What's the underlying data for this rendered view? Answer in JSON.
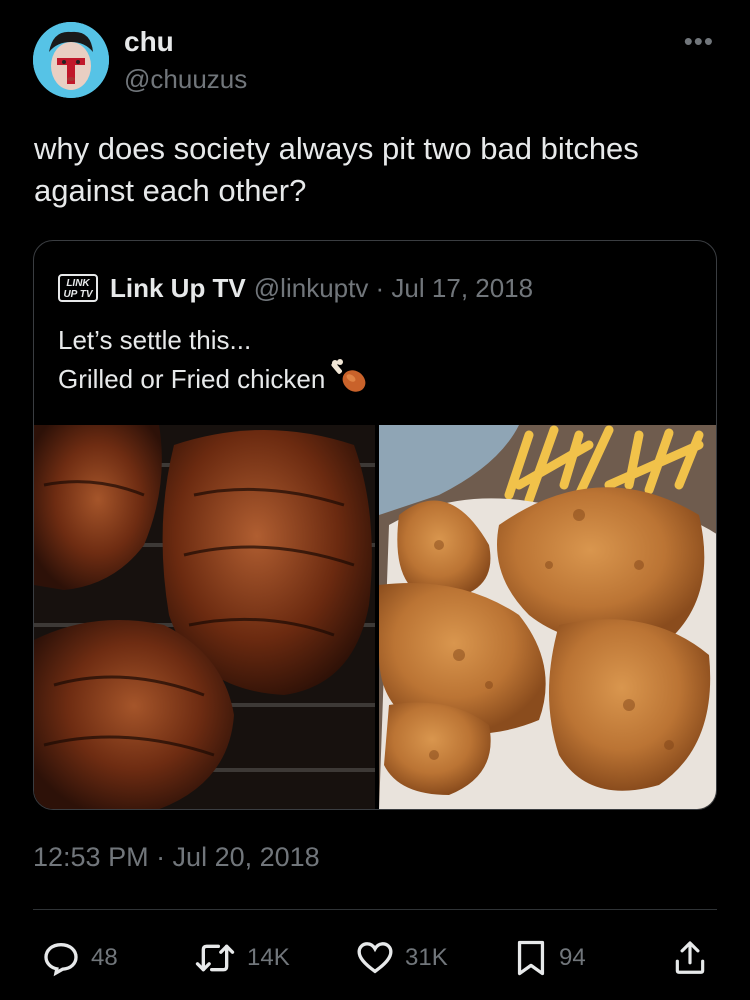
{
  "author": {
    "display_name": "chu",
    "handle": "@chuuzus"
  },
  "tweet": {
    "text": "why does society always pit two bad bitches against each other?",
    "timestamp": "12:53 PM · Jul 20, 2018"
  },
  "quoted": {
    "logo_text_line1": "LINK",
    "logo_text_line2": "UP TV",
    "display_name": "Link Up TV",
    "meta": "@linkuptv · Jul 17, 2018",
    "line1": "Let’s settle this...",
    "line2": "Grilled or Fried chicken",
    "emoji": "poultry-leg-icon",
    "images": [
      "grilled-chicken-photo",
      "fried-chicken-photo"
    ]
  },
  "actions": {
    "replies": "48",
    "retweets": "14K",
    "likes": "31K",
    "bookmarks": "94"
  },
  "colors": {
    "background": "#000000",
    "text": "#e7e9ea",
    "muted": "#71767b",
    "border": "#2f3336"
  }
}
